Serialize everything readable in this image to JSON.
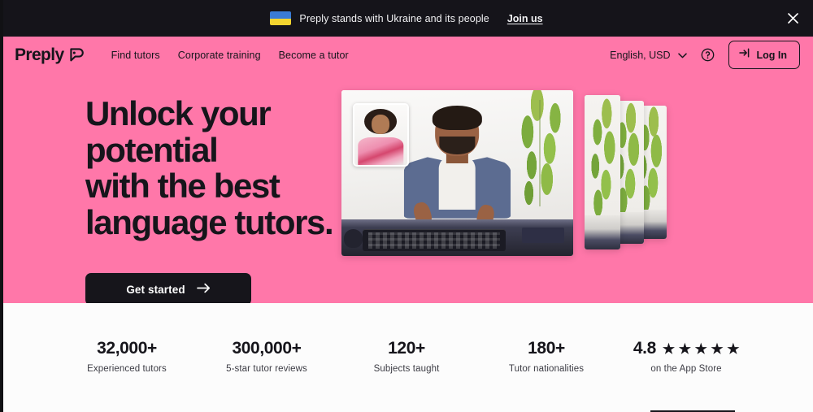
{
  "banner": {
    "flag_icon": "ukraine-flag-icon",
    "text": "Preply stands with Ukraine and its people",
    "link_label": "Join us",
    "close_icon": "close-icon"
  },
  "header": {
    "brand": "Preply",
    "brand_mark_icon": "preply-speech-bubble-icon",
    "nav_links": [
      {
        "label": "Find tutors"
      },
      {
        "label": "Corporate training"
      },
      {
        "label": "Become a tutor"
      }
    ],
    "locale": {
      "label": "English, USD",
      "chevron_icon": "chevron-down-icon"
    },
    "help_icon": "help-circle-icon",
    "login": {
      "label": "Log In",
      "icon": "login-arrow-icon"
    }
  },
  "hero": {
    "headline_line_1": "Unlock your potential",
    "headline_line_2": "with the best",
    "headline_line_3": "language tutors.",
    "cta_label": "Get started",
    "cta_icon": "arrow-right-icon",
    "background_color": "#FF77A9",
    "media": {
      "main_slide_alt": "tutor-video-call-image",
      "pip_alt": "student-picture-in-picture-image",
      "peek_slide_count": 3
    }
  },
  "stats": [
    {
      "value": "32,000+",
      "label": "Experienced tutors"
    },
    {
      "value": "300,000+",
      "label": "5-star tutor reviews"
    },
    {
      "value": "120+",
      "label": "Subjects taught"
    },
    {
      "value": "180+",
      "label": "Tutor nationalities"
    },
    {
      "value": "4.8",
      "label": "on the App Store",
      "stars": 5,
      "star_glyph": "★"
    }
  ],
  "colors": {
    "pink": "#FF77A9",
    "dark": "#16151B",
    "banner_bg": "#15141A",
    "page_bg": "#FCFCFC"
  }
}
